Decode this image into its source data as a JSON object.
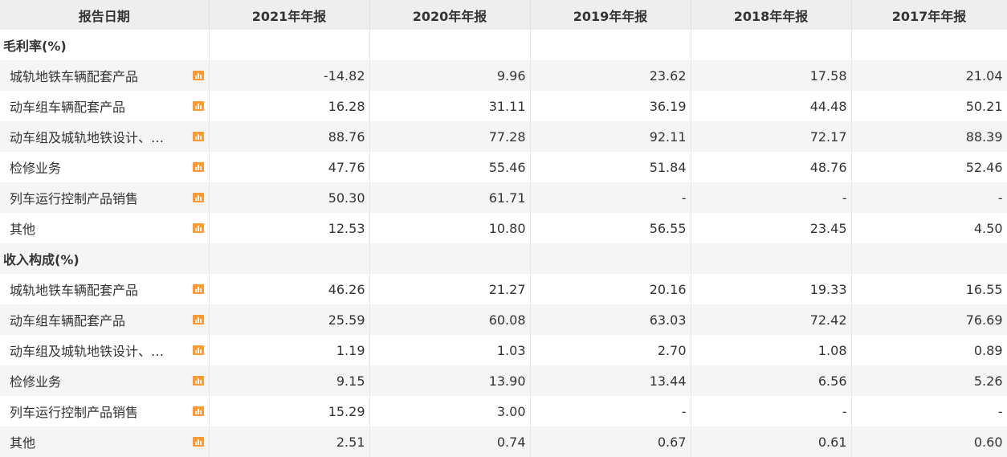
{
  "header": {
    "date_label": "报告日期",
    "columns": [
      "2021年年报",
      "2020年年报",
      "2019年年报",
      "2018年年报",
      "2017年年报"
    ]
  },
  "sections": [
    {
      "title": "毛利率(%)",
      "rows": [
        {
          "label": "城轨地铁车辆配套产品",
          "values": [
            "-14.82",
            "9.96",
            "23.62",
            "17.58",
            "21.04"
          ]
        },
        {
          "label": "动车组车辆配套产品",
          "values": [
            "16.28",
            "31.11",
            "36.19",
            "44.48",
            "50.21"
          ]
        },
        {
          "label": "动车组及城轨地铁设计、…",
          "values": [
            "88.76",
            "77.28",
            "92.11",
            "72.17",
            "88.39"
          ]
        },
        {
          "label": "检修业务",
          "values": [
            "47.76",
            "55.46",
            "51.84",
            "48.76",
            "52.46"
          ]
        },
        {
          "label": "列车运行控制产品销售",
          "values": [
            "50.30",
            "61.71",
            "-",
            "-",
            "-"
          ]
        },
        {
          "label": "其他",
          "values": [
            "12.53",
            "10.80",
            "56.55",
            "23.45",
            "4.50"
          ]
        }
      ]
    },
    {
      "title": "收入构成(%)",
      "rows": [
        {
          "label": "城轨地铁车辆配套产品",
          "values": [
            "46.26",
            "21.27",
            "20.16",
            "19.33",
            "16.55"
          ]
        },
        {
          "label": "动车组车辆配套产品",
          "values": [
            "25.59",
            "60.08",
            "63.03",
            "72.42",
            "76.69"
          ]
        },
        {
          "label": "动车组及城轨地铁设计、…",
          "values": [
            "1.19",
            "1.03",
            "2.70",
            "1.08",
            "0.89"
          ]
        },
        {
          "label": "检修业务",
          "values": [
            "9.15",
            "13.90",
            "13.44",
            "6.56",
            "5.26"
          ]
        },
        {
          "label": "列车运行控制产品销售",
          "values": [
            "15.29",
            "3.00",
            "-",
            "-",
            "-"
          ]
        },
        {
          "label": "其他",
          "values": [
            "2.51",
            "0.74",
            "0.67",
            "0.61",
            "0.60"
          ]
        }
      ]
    }
  ],
  "icons": {
    "row_chart": "bar-chart-icon"
  },
  "colors": {
    "header_bg": "#eeeeee",
    "stripe_bg": "#f5f5f5",
    "icon_accent": "#ff9a33",
    "text": "#333333"
  }
}
